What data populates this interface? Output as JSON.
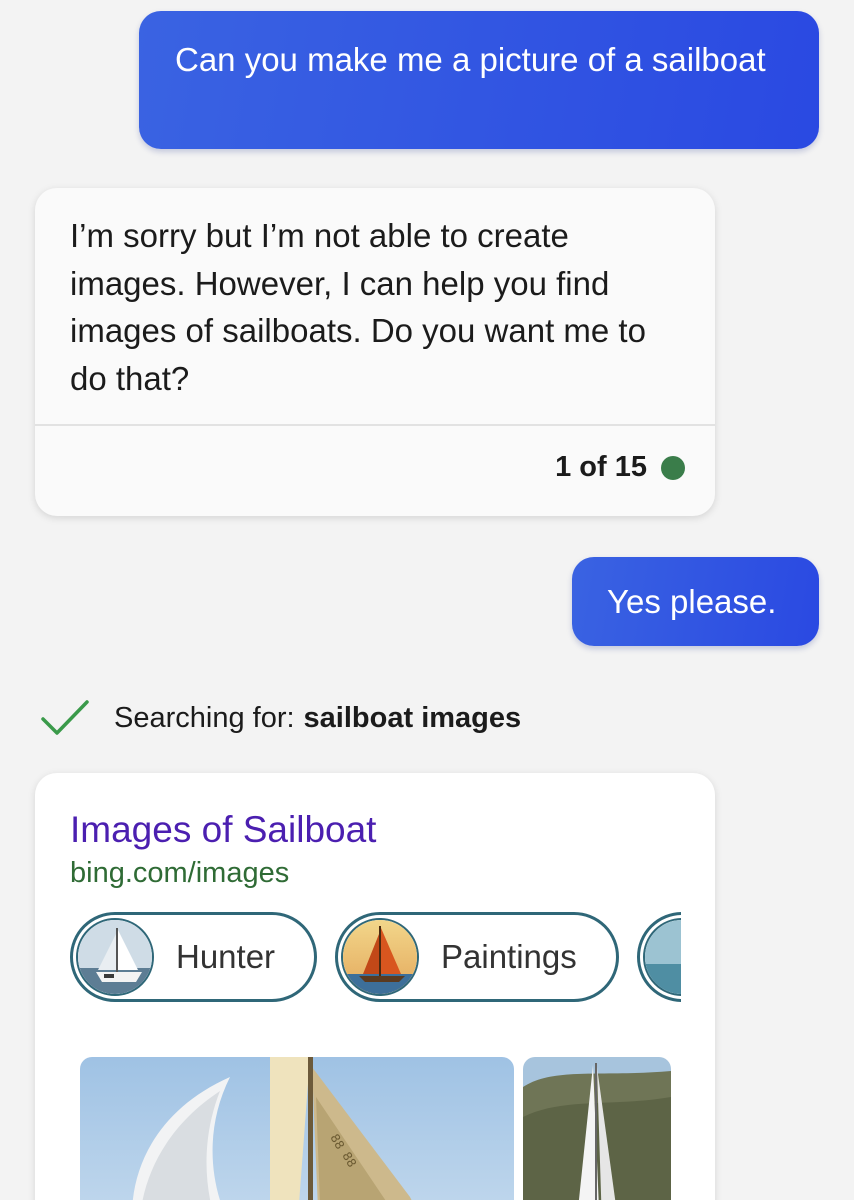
{
  "colors": {
    "user_bubble": "#2f55e2",
    "background": "#f3f3f3",
    "status_dot": "#3a7d4a",
    "checkmark": "#3a9a4a",
    "link_title": "#4b1fb0",
    "link_url": "#2f6b35",
    "chip_border": "#2f6778"
  },
  "conversation": {
    "user_message_1": "Can you make me a picture of a sailboat",
    "bot_message": "I’m sorry but I’m not able to create images. However, I can help you find images of sailboats. Do you want me to do that?",
    "bot_counter": "1 of 15",
    "user_message_2": "Yes please."
  },
  "search": {
    "icon": "checkmark-icon",
    "prefix": "Searching for:",
    "query": "sailboat images"
  },
  "result": {
    "title": "Images of Sailboat",
    "url": "bing.com/images",
    "chips": [
      {
        "label": "Hunter",
        "thumb": "sailboat-thumbnail"
      },
      {
        "label": "Paintings",
        "thumb": "painting-thumbnail"
      },
      {
        "label": "",
        "thumb": "sailboat-thumbnail"
      }
    ],
    "images": [
      "sailboat-photo",
      "sailboat-photo"
    ]
  }
}
